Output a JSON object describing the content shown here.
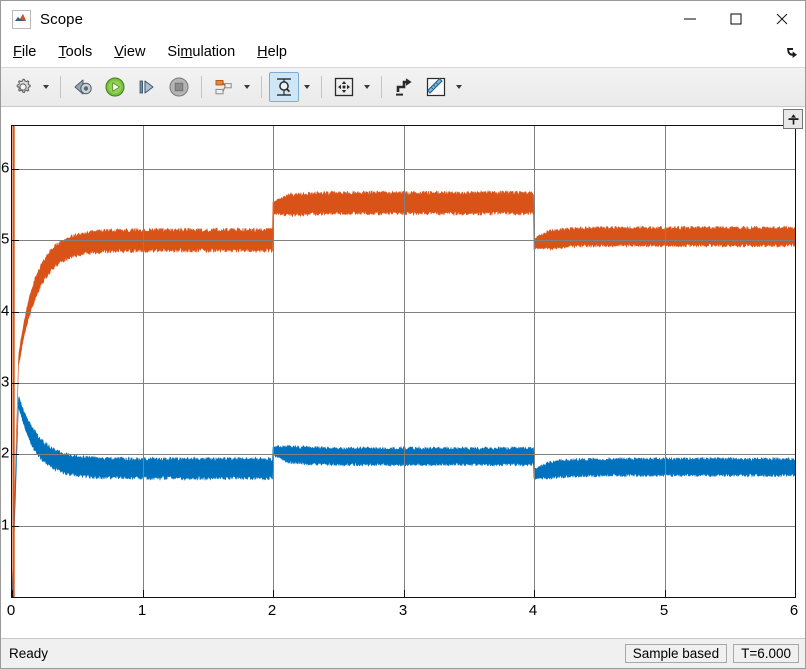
{
  "window": {
    "title": "Scope",
    "app_icon": "matlab-scope-icon",
    "controls": [
      {
        "name": "minimize-button",
        "glyph": "minimize-icon"
      },
      {
        "name": "maximize-button",
        "glyph": "maximize-icon"
      },
      {
        "name": "close-button",
        "glyph": "close-icon"
      }
    ]
  },
  "menubar": {
    "items": [
      {
        "label": "File",
        "accel": "F"
      },
      {
        "label": "Tools",
        "accel": "T"
      },
      {
        "label": "View",
        "accel": "V"
      },
      {
        "label": "Simulation",
        "accel": "S"
      },
      {
        "label": "Help",
        "accel": "H"
      }
    ],
    "dock_icon": "undock-arrow-icon"
  },
  "toolbar": {
    "buttons": [
      {
        "name": "configuration-properties-button",
        "icon": "gear-icon",
        "caret": true,
        "active": false,
        "tooltip": "Configuration Properties"
      },
      {
        "name": "step-back-button",
        "icon": "step-back-icon",
        "caret": false,
        "active": false,
        "tooltip": "Step Back"
      },
      {
        "name": "run-button",
        "icon": "run-play-icon",
        "caret": false,
        "active": false,
        "tooltip": "Run"
      },
      {
        "name": "step-forward-button",
        "icon": "step-forward-icon",
        "caret": false,
        "active": false,
        "tooltip": "Step Forward"
      },
      {
        "name": "stop-button",
        "icon": "stop-icon",
        "caret": false,
        "active": false,
        "tooltip": "Stop"
      },
      {
        "name": "signal-selection-button",
        "icon": "signal-blocks-icon",
        "caret": true,
        "active": false,
        "tooltip": "Signal Selection"
      },
      {
        "name": "cursor-measurements-button",
        "icon": "cursor-measure-icon",
        "caret": true,
        "active": true,
        "tooltip": "Cursor Measurements"
      },
      {
        "name": "pan-button",
        "icon": "pan-arrows-icon",
        "caret": true,
        "active": false,
        "tooltip": "Pan"
      },
      {
        "name": "zoom-in-y-button",
        "icon": "zoom-y-icon",
        "caret": false,
        "active": false,
        "tooltip": "Zoom in Y"
      },
      {
        "name": "style-button",
        "icon": "style-ruler-icon",
        "caret": true,
        "active": false,
        "tooltip": "Style"
      }
    ]
  },
  "plot": {
    "pin_icon": "maximize-axes-pin-icon"
  },
  "statusbar": {
    "ready_label": "Ready",
    "frame_mode": "Sample based",
    "time": "T=6.000"
  },
  "chart_data": {
    "type": "line",
    "title": "",
    "xlabel": "",
    "ylabel": "",
    "xlim": [
      0,
      6
    ],
    "ylim": [
      0,
      6.6
    ],
    "grid": true,
    "legend": false,
    "xticks": [
      0,
      1,
      2,
      3,
      4,
      5,
      6
    ],
    "xtick_labels": [
      "0",
      "1",
      "2",
      "3",
      "4",
      "5",
      "6"
    ],
    "yticks": [
      1,
      2,
      3,
      4,
      5,
      6
    ],
    "ytick_labels": [
      "1",
      "2",
      "3",
      "4",
      "5",
      "6"
    ],
    "colors": {
      "series1": "#0072BD",
      "series2": "#D95319"
    },
    "series": [
      {
        "name": "signal-2-upper",
        "color": "#D95319",
        "description": "Noisy band settling near 5.0, steps up at t=2 to ~5.5, steps back at t=4 to ~5.0",
        "segments": [
          {
            "t_start": 0.0,
            "t_end": 0.05,
            "value_start": 0.0,
            "value_end": 3.3,
            "band": 0.05,
            "shape": "spike"
          },
          {
            "t_start": 0.05,
            "t_end": 2.0,
            "value_start": 3.3,
            "value_end": 5.0,
            "band": 0.28,
            "shape": "exp_settle"
          },
          {
            "t_start": 2.0,
            "t_end": 4.0,
            "value_start": 5.45,
            "value_end": 5.52,
            "band": 0.28,
            "shape": "exp_settle"
          },
          {
            "t_start": 4.0,
            "t_end": 6.0,
            "value_start": 4.95,
            "value_end": 5.05,
            "band": 0.24,
            "shape": "exp_settle"
          }
        ]
      },
      {
        "name": "signal-1-lower",
        "color": "#0072BD",
        "description": "Noisy band settling near 1.8, steps up at t=2 to ~1.95, steps down at t=4 to ~1.8",
        "segments": [
          {
            "t_start": 0.0,
            "t_end": 0.05,
            "value_start": 0.0,
            "value_end": 2.75,
            "band": 0.05,
            "shape": "spike"
          },
          {
            "t_start": 0.05,
            "t_end": 2.0,
            "value_start": 2.75,
            "value_end": 1.8,
            "band": 0.26,
            "shape": "exp_settle"
          },
          {
            "t_start": 2.0,
            "t_end": 4.0,
            "value_start": 2.05,
            "value_end": 1.97,
            "band": 0.22,
            "shape": "exp_settle"
          },
          {
            "t_start": 4.0,
            "t_end": 6.0,
            "value_start": 1.72,
            "value_end": 1.82,
            "band": 0.22,
            "shape": "exp_settle"
          }
        ]
      }
    ]
  }
}
